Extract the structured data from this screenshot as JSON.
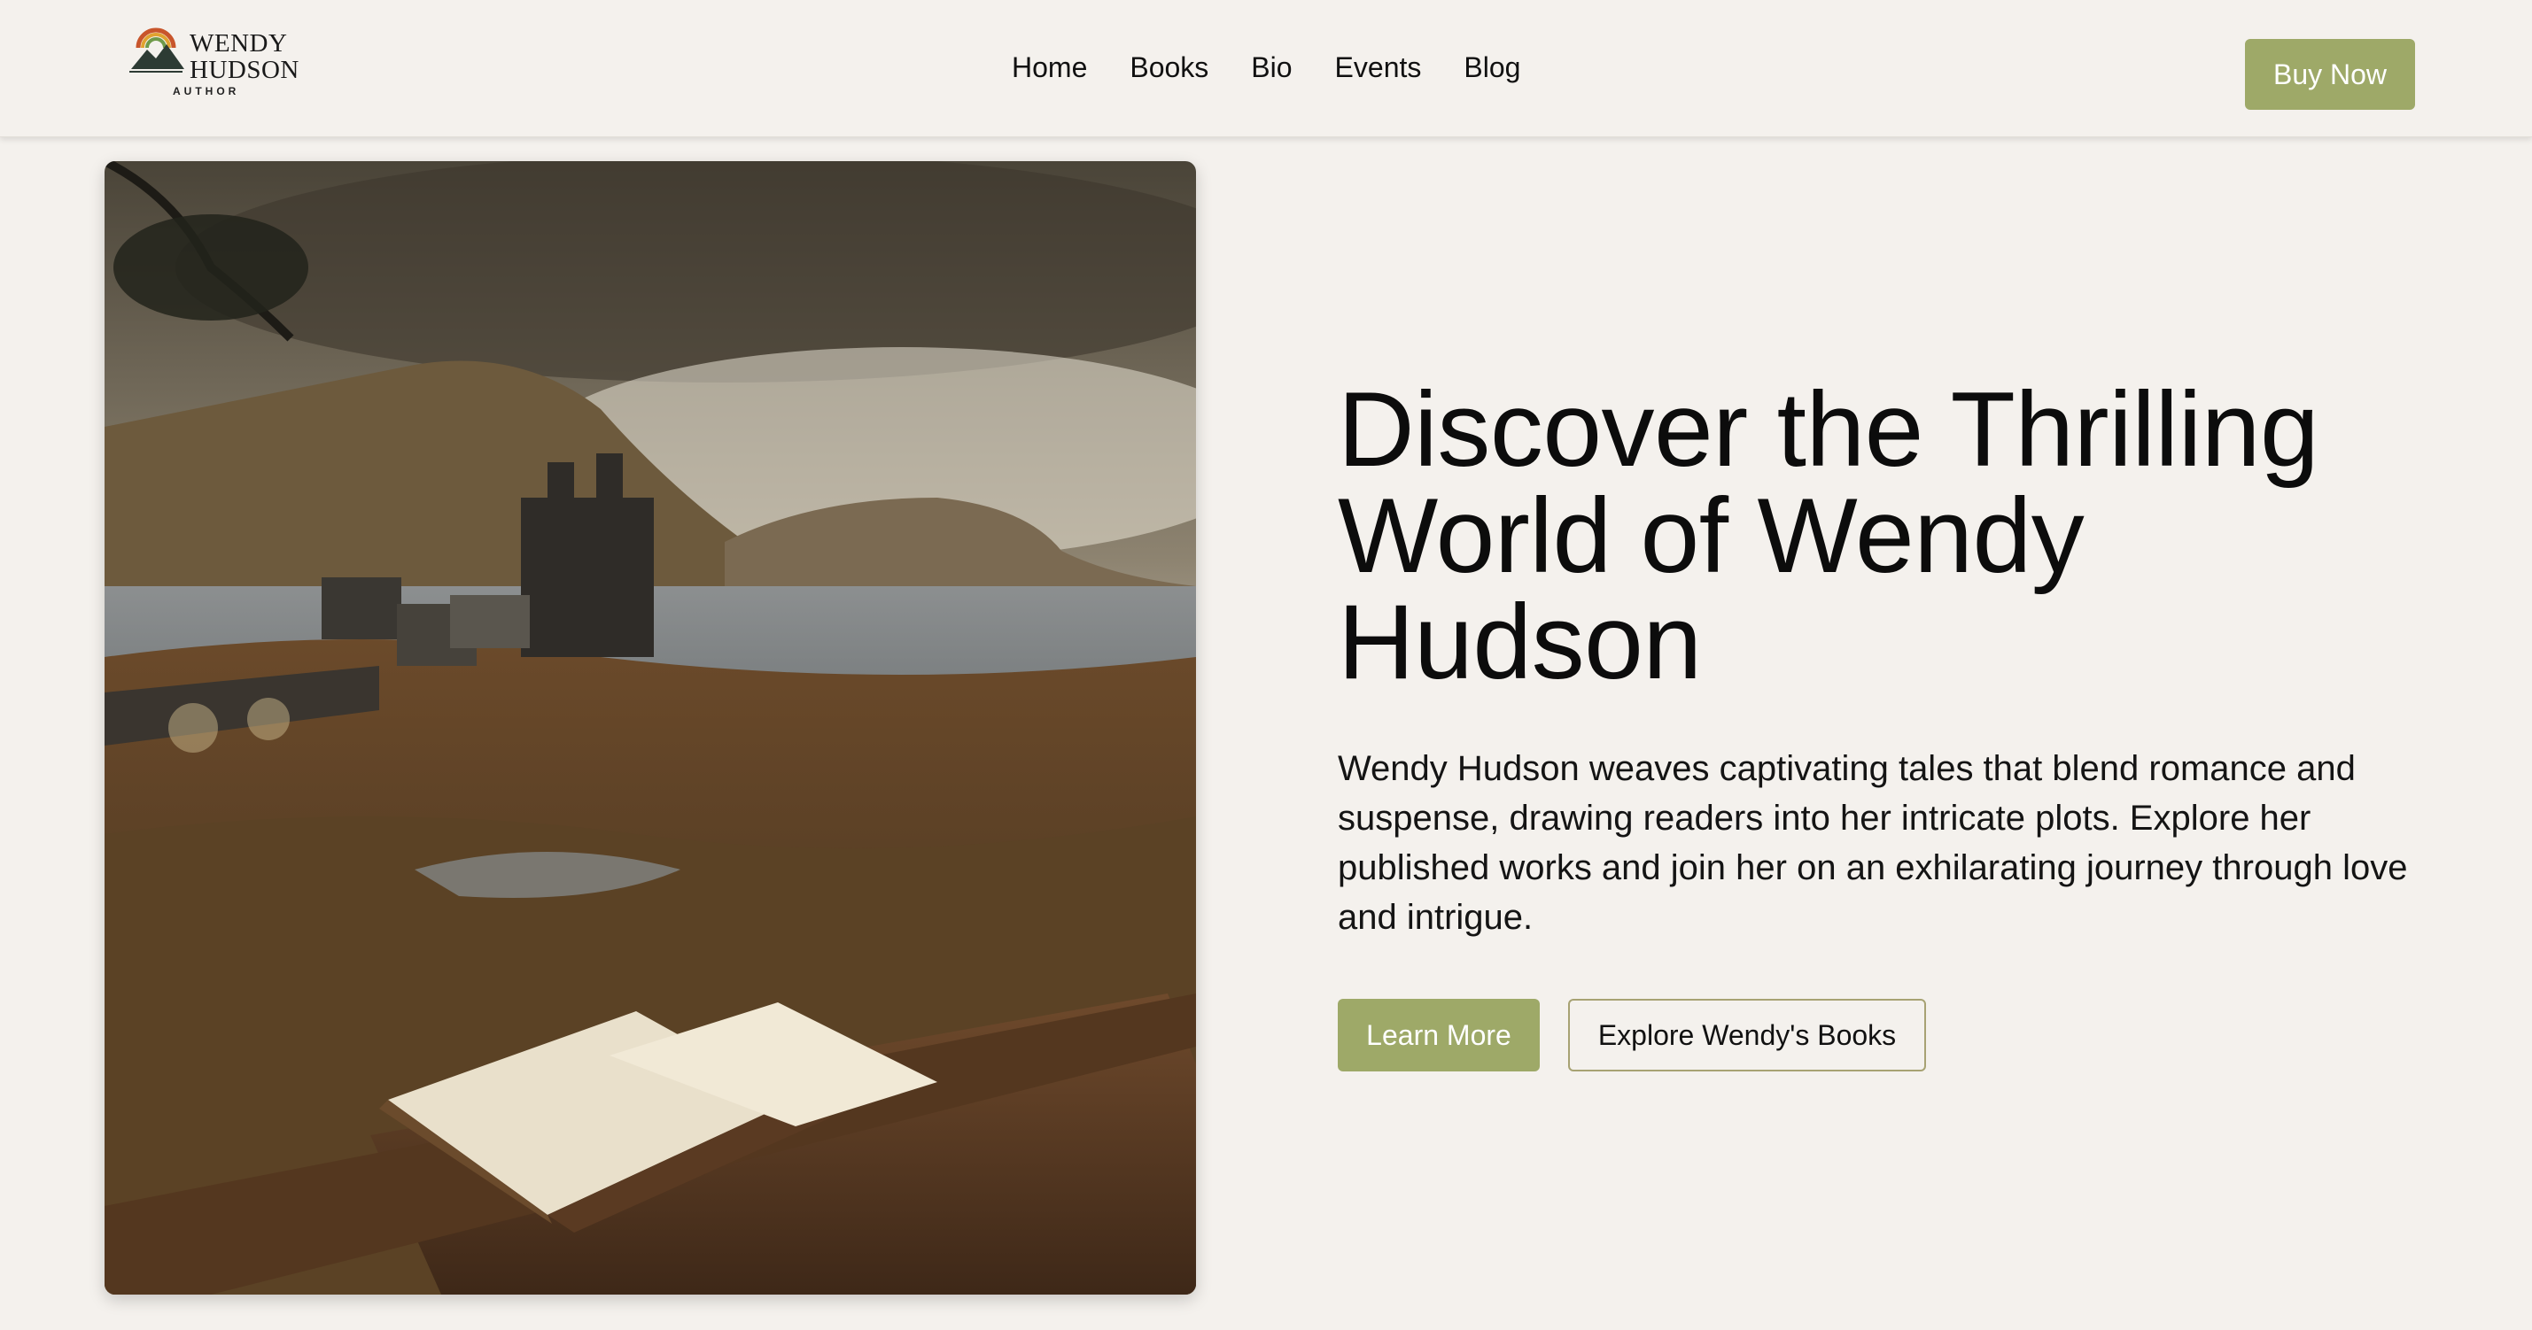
{
  "brand": {
    "name": "WENDY\nHUDSON",
    "tagline": "AUTHOR",
    "logo_icon": "rainbow-mountain-icon"
  },
  "nav": {
    "items": [
      {
        "label": "Home"
      },
      {
        "label": "Books"
      },
      {
        "label": "Bio"
      },
      {
        "label": "Events"
      },
      {
        "label": "Blog"
      }
    ],
    "cta_label": "Buy Now"
  },
  "hero": {
    "image": "castle-loch-book-on-bench-image",
    "headline": "Discover the Thrilling World of Wendy Hudson",
    "lead": "Wendy Hudson weaves captivating tales that blend romance and suspense, drawing readers into her intricate plots. Explore her published works and join her on an exhilarating journey through love and intrigue.",
    "primary_button": "Learn More",
    "secondary_button": "Explore Wendy's Books"
  },
  "colors": {
    "background": "#f4f1ed",
    "accent": "#9ea968",
    "outline": "#a7a273"
  }
}
